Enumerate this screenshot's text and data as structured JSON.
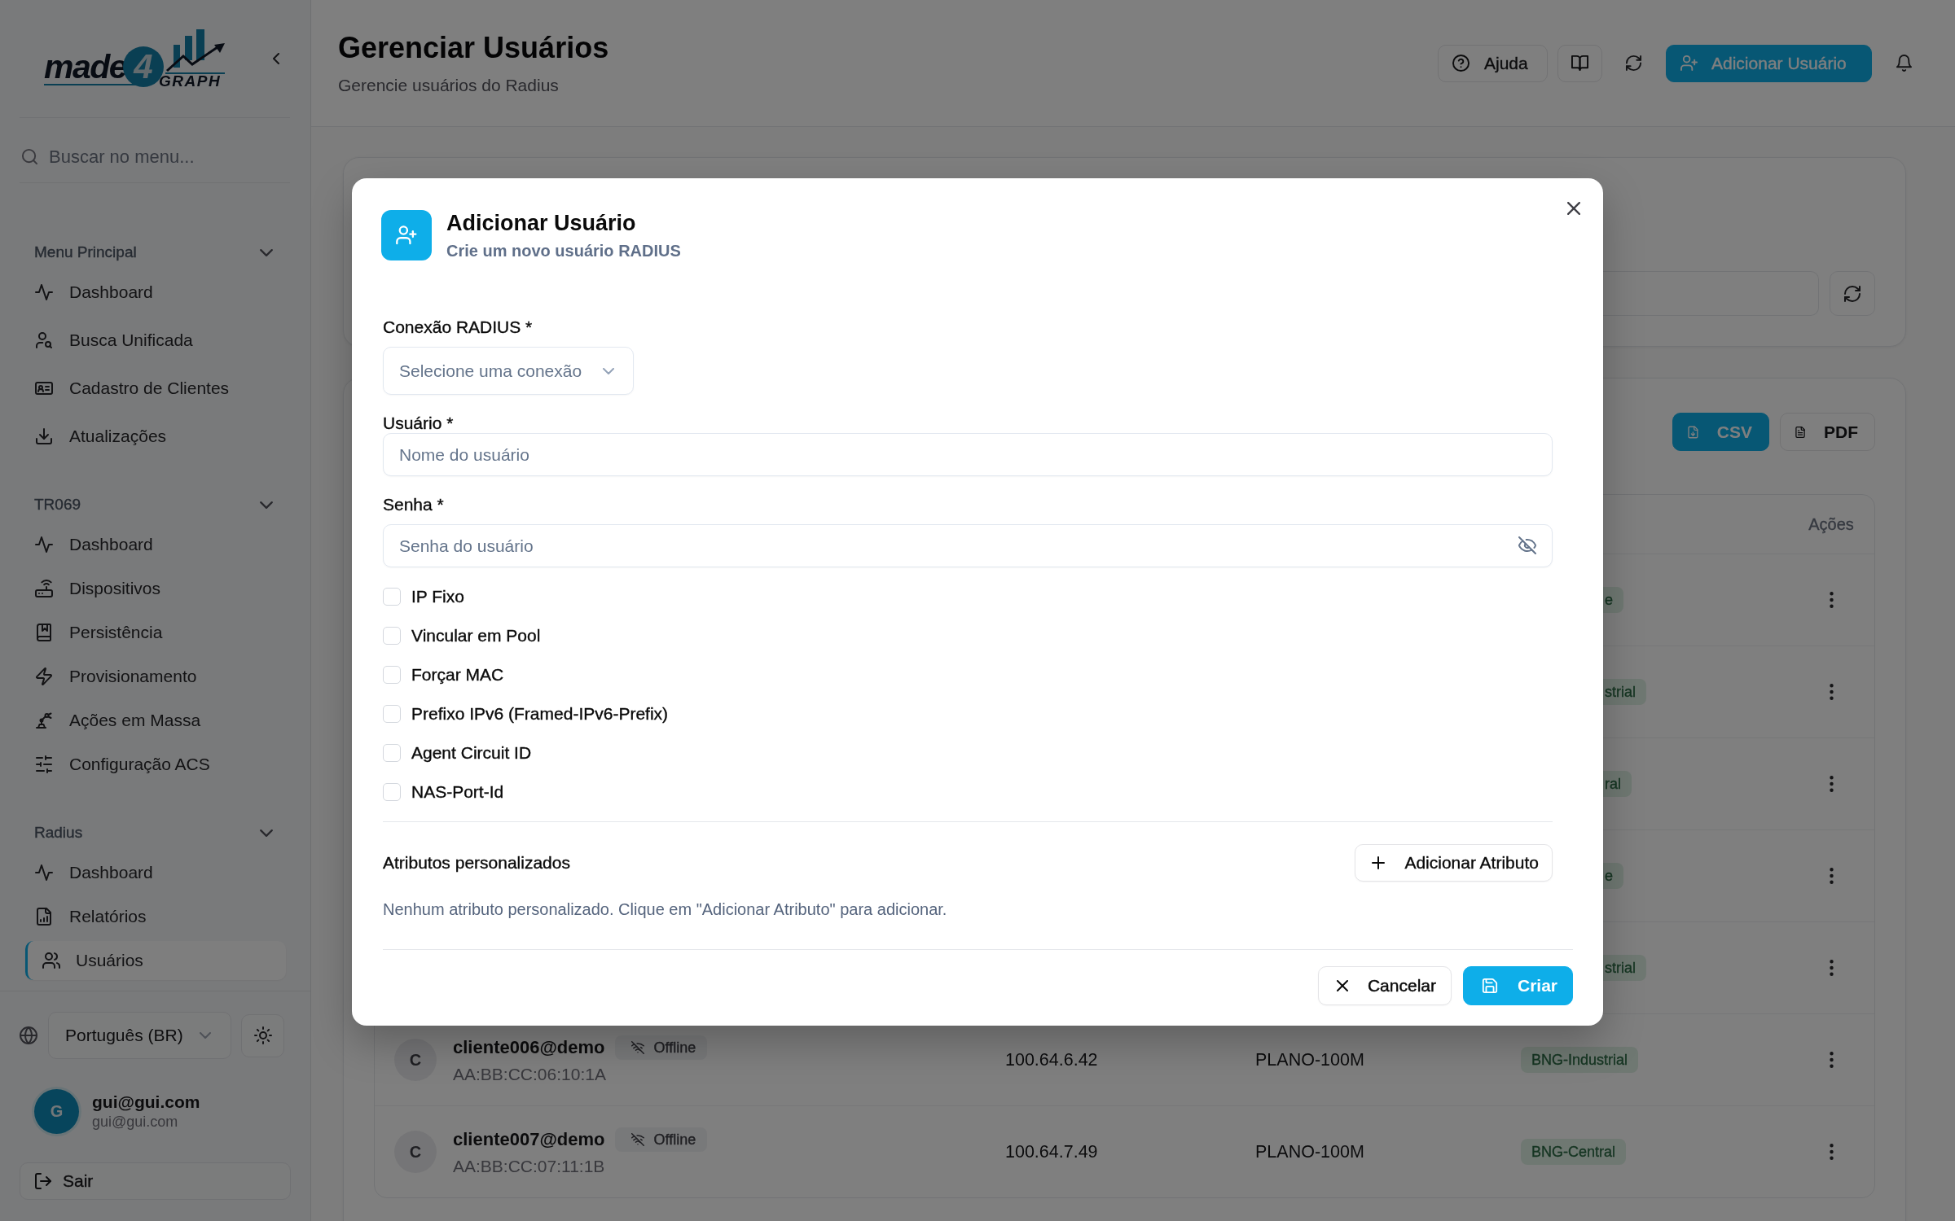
{
  "sidebar": {
    "logo": {
      "word": "made",
      "digit": "4",
      "tagline": "GRAPH"
    },
    "search": {
      "placeholder": "Buscar no menu..."
    },
    "sections": [
      {
        "title": "Menu Principal",
        "expanded": true,
        "items": [
          {
            "label": "Dashboard",
            "selected": false
          },
          {
            "label": "Busca Unificada",
            "selected": false
          },
          {
            "label": "Cadastro de Clientes",
            "selected": false
          },
          {
            "label": "Atualizações",
            "selected": false
          }
        ]
      },
      {
        "title": "TR069",
        "expanded": true,
        "items": [
          {
            "label": "Dashboard",
            "selected": false
          },
          {
            "label": "Dispositivos",
            "selected": false
          },
          {
            "label": "Persistência",
            "selected": false
          },
          {
            "label": "Provisionamento",
            "selected": false
          },
          {
            "label": "Ações em Massa",
            "selected": false
          },
          {
            "label": "Configuração ACS",
            "selected": false
          }
        ]
      },
      {
        "title": "Radius",
        "expanded": true,
        "items": [
          {
            "label": "Dashboard",
            "selected": false
          },
          {
            "label": "Relatórios",
            "selected": false
          },
          {
            "label": "Usuários",
            "selected": true
          }
        ]
      }
    ],
    "language": {
      "value": "Português (BR)"
    },
    "user": {
      "initial": "G",
      "name": "gui@gui.com",
      "email": "gui@gui.com"
    },
    "logout": "Sair"
  },
  "header": {
    "title": "Gerenciar Usuários",
    "subtitle": "Gerencie usuários do Radius",
    "help_button": "Ajuda",
    "add_button": "Adicionar Usuário"
  },
  "export_buttons": [
    {
      "label": "CSV",
      "kind": "primary"
    },
    {
      "label": "PDF",
      "kind": "outline"
    }
  ],
  "table": {
    "actions_heading": "Ações",
    "rows": [
      {
        "kind": "partial",
        "tag": "e"
      },
      {
        "kind": "partial",
        "tag": "strial"
      },
      {
        "kind": "partial",
        "tag": "ral"
      },
      {
        "kind": "partial",
        "tag": "e"
      },
      {
        "kind": "partial",
        "tag": "strial"
      },
      {
        "kind": "full",
        "initial": "C",
        "user": "cliente006@demo",
        "status": "Offline",
        "mac": "AA:BB:CC:06:10:1A",
        "ip": "100.64.6.42",
        "plan": "PLANO-100M",
        "tag": "BNG-Industrial"
      },
      {
        "kind": "full",
        "initial": "C",
        "user": "cliente007@demo",
        "status": "Offline",
        "mac": "AA:BB:CC:07:11:1B",
        "ip": "100.64.7.49",
        "plan": "PLANO-100M",
        "tag": "BNG-Central"
      }
    ]
  },
  "dialog": {
    "title": "Adicionar Usuário",
    "subtitle": "Crie um novo usuário RADIUS",
    "fields": [
      {
        "kind": "select",
        "label": "Conexão RADIUS *",
        "placeholder": "Selecione uma conexão"
      },
      {
        "kind": "text",
        "label": "Usuário *",
        "placeholder": "Nome do usuário"
      },
      {
        "kind": "password",
        "label": "Senha *",
        "placeholder": "Senha do usuário"
      }
    ],
    "options": [
      {
        "label": "IP Fixo",
        "checked": false
      },
      {
        "label": "Vincular em Pool",
        "checked": false
      },
      {
        "label": "Forçar MAC",
        "checked": false
      },
      {
        "label": "Prefixo IPv6 (Framed-IPv6-Prefix)",
        "checked": false
      },
      {
        "label": "Agent Circuit ID",
        "checked": false
      },
      {
        "label": "NAS-Port-Id",
        "checked": false
      }
    ],
    "custom_attributes": {
      "title": "Atributos personalizados",
      "add_button": "Adicionar Atributo",
      "empty_text": "Nenhum atributo personalizado. Clique em \"Adicionar Atributo\" para adicionar."
    },
    "buttons": [
      {
        "label": "Cancelar",
        "kind": "secondary"
      },
      {
        "label": "Criar",
        "kind": "primary"
      }
    ]
  }
}
